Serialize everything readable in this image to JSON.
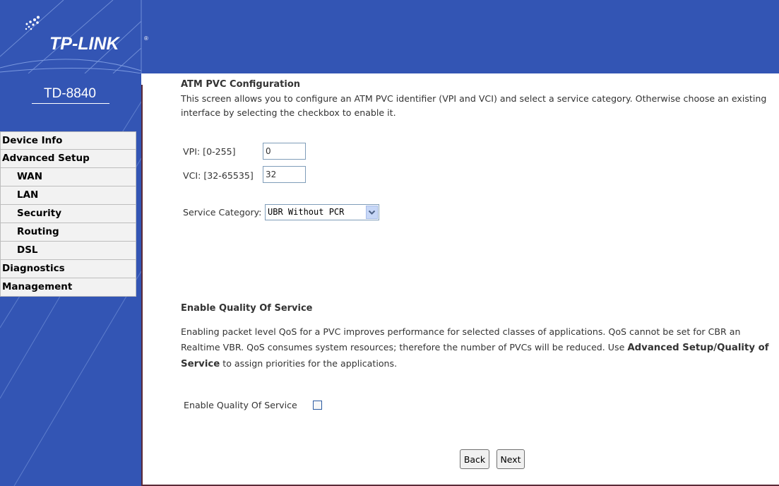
{
  "header": {
    "brand": "TP-LINK",
    "brand_mark": "®"
  },
  "sidebar": {
    "model": "TD-8840",
    "items": [
      {
        "label": "Device Info",
        "sub": false
      },
      {
        "label": "Advanced Setup",
        "sub": false
      },
      {
        "label": "WAN",
        "sub": true
      },
      {
        "label": "LAN",
        "sub": true
      },
      {
        "label": "Security",
        "sub": true
      },
      {
        "label": "Routing",
        "sub": true
      },
      {
        "label": "DSL",
        "sub": true
      },
      {
        "label": "Diagnostics",
        "sub": false
      },
      {
        "label": "Management",
        "sub": false
      }
    ]
  },
  "atm": {
    "title": "ATM PVC Configuration",
    "description": "This screen allows you to configure an ATM PVC identifier (VPI and VCI) and select a service category. Otherwise choose an existing interface by selecting the checkbox to enable it.",
    "vpi_label": "VPI: [0-255]",
    "vpi_value": "0",
    "vci_label": "VCI: [32-65535]",
    "vci_value": "32",
    "service_label": "Service Category:",
    "service_value": "UBR Without PCR"
  },
  "qos": {
    "title": "Enable Quality Of Service",
    "desc_part1": "Enabling packet level QoS for a PVC improves performance for selected classes of applications.  QoS cannot be set for CBR an",
    "desc_part2": "Realtime VBR.  QoS consumes system resources; therefore the number of PVCs will be reduced. Use ",
    "desc_bold": "Advanced Setup/Quality of Service",
    "desc_part3": " to assign priorities for the applications.",
    "checkbox_label": "Enable Quality Of Service",
    "checked": false
  },
  "buttons": {
    "back": "Back",
    "next": "Next"
  },
  "colors": {
    "header_blue": "#3355b4",
    "panel_border": "#5b2a38",
    "menu_bg": "#f2f2f2"
  }
}
